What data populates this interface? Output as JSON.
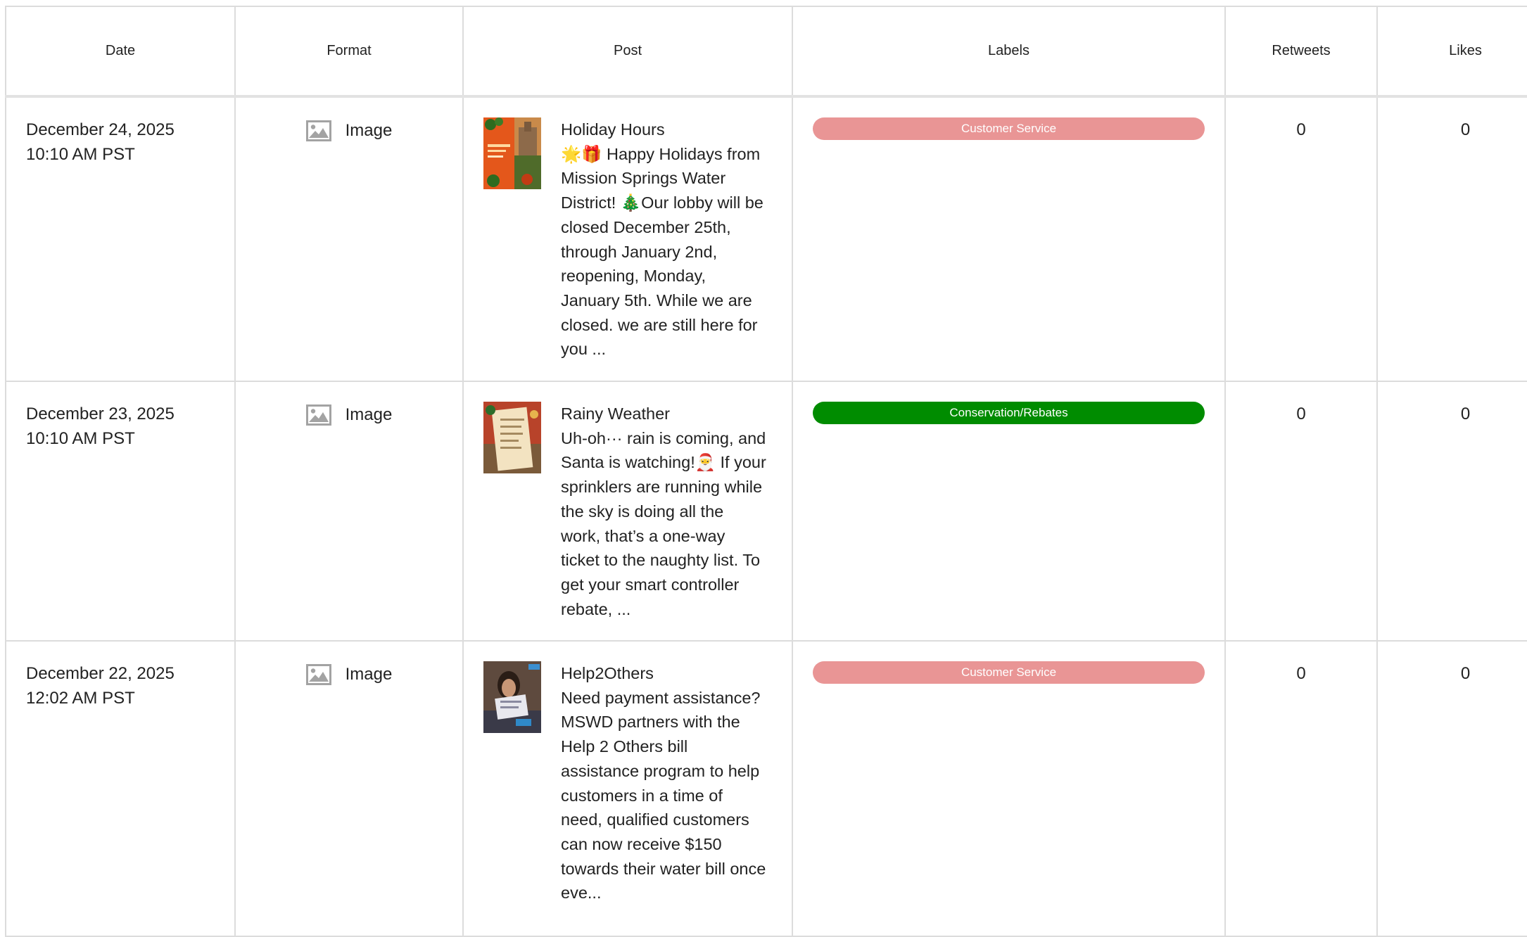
{
  "columns": {
    "date": "Date",
    "format": "Format",
    "post": "Post",
    "labels": "Labels",
    "retweets": "Retweets",
    "likes": "Likes"
  },
  "icons": {
    "format": "image-icon"
  },
  "colors": {
    "customer_service": "#e99595",
    "conservation": "#008c00",
    "border": "#dcdcdc",
    "icon_gray": "#a3a3a3"
  },
  "rows": [
    {
      "date": "December 24, 2025",
      "time": "10:10 AM PST",
      "format": "Image",
      "post_title": "Holiday Hours",
      "post_body": "🌟🎁 Happy Holidays from Mission Springs Water District! 🎄Our lobby will be closed December 25th, through January 2nd, reopening, Monday, January 5th. While we are closed. we are still here for you ...",
      "label": "Customer Service",
      "retweets": "0",
      "likes": "0"
    },
    {
      "date": "December 23, 2025",
      "time": "10:10 AM PST",
      "format": "Image",
      "post_title": "Rainy Weather",
      "post_body": "Uh-oh··· rain is coming, and Santa is watching!🎅 If your sprinklers are running while the sky is doing all the work, that’s a one-way ticket to the naughty list. To get your smart controller rebate, ...",
      "label": "Conservation/Rebates",
      "retweets": "0",
      "likes": "0"
    },
    {
      "date": "December 22, 2025",
      "time": "12:02 AM PST",
      "format": "Image",
      "post_title": "Help2Others",
      "post_body": "Need payment assistance? MSWD partners with the Help 2 Others bill assistance program to help customers in a time of need, qualified customers can now receive $150 towards their water bill once eve...",
      "label": "Customer Service",
      "retweets": "0",
      "likes": "0"
    }
  ]
}
